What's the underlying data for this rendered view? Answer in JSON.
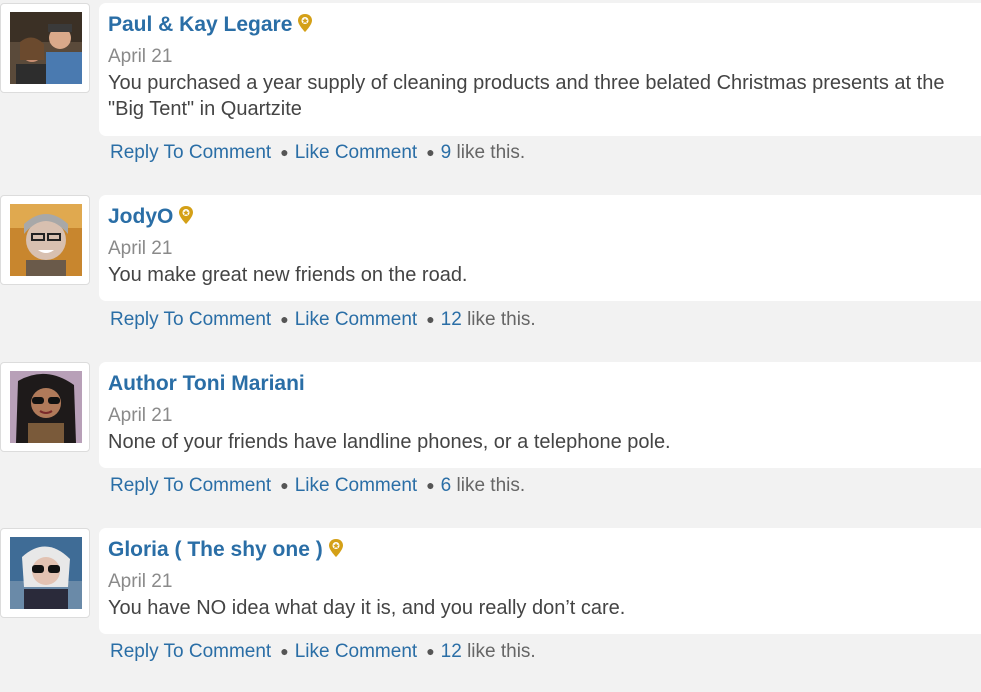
{
  "comments": [
    {
      "author": "Paul & Kay Legare",
      "has_badge": true,
      "date": "April 21",
      "text": "You purchased a year supply of cleaning products and three belated Christmas presents at the \"Big Tent\" in Quartzite",
      "reply_label": "Reply To Comment",
      "like_label": "Like Comment",
      "like_count": "9",
      "like_suffix": "like this."
    },
    {
      "author": "JodyO",
      "has_badge": true,
      "date": "April 21",
      "text": "You make great new friends on the road.",
      "reply_label": "Reply To Comment",
      "like_label": "Like Comment",
      "like_count": "12",
      "like_suffix": "like this."
    },
    {
      "author": "Author Toni Mariani",
      "has_badge": false,
      "date": "April 21",
      "text": "None of your friends have landline phones, or a telephone pole.",
      "reply_label": "Reply To Comment",
      "like_label": "Like Comment",
      "like_count": "6",
      "like_suffix": "like this."
    },
    {
      "author": "Gloria ( The shy one )",
      "has_badge": true,
      "date": "April 21",
      "text": "You have NO idea what day it is, and you really don’t care.",
      "reply_label": "Reply To Comment",
      "like_label": "Like Comment",
      "like_count": "12",
      "like_suffix": "like this."
    }
  ],
  "colors": {
    "link": "#2a6ea6",
    "badge": "#d4a017",
    "date": "#8a8a8a",
    "body_text": "#444444",
    "background": "#f2f2f2"
  },
  "icons": {
    "badge": "map-pin-badge-icon"
  }
}
